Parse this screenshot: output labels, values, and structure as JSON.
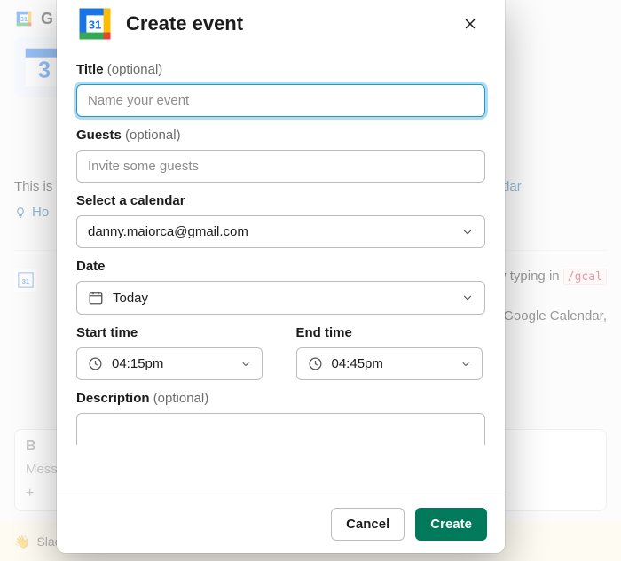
{
  "modal": {
    "title": "Create event",
    "fields": {
      "title": {
        "label": "Title",
        "optional": "(optional)",
        "placeholder": "Name your event"
      },
      "guests": {
        "label": "Guests",
        "optional": "(optional)",
        "placeholder": "Invite some guests"
      },
      "calendar": {
        "label": "Select a calendar",
        "value": "danny.maiorca@gmail.com"
      },
      "date": {
        "label": "Date",
        "value": "Today"
      },
      "start": {
        "label": "Start time",
        "value": "04:15pm"
      },
      "end": {
        "label": "End time",
        "value": "04:45pm"
      },
      "description": {
        "label": "Description",
        "optional": "(optional)"
      }
    },
    "buttons": {
      "cancel": "Cancel",
      "create": "Create"
    }
  },
  "background": {
    "header": "G",
    "intro_prefix": "This is",
    "link": "alendar",
    "hint": "Ho",
    "row1_right": "by typing in ",
    "row1_code": "/gcal",
    "row2_right": "g Google Calendar,",
    "composer_b": "B",
    "composer_msg": "Mess",
    "composer_plus": "+",
    "footer_text": "Slack needs your permission to enable notifications. Enable notifications"
  },
  "colors": {
    "primary_button": "#007a5a",
    "focus_ring": "#1d9bd1",
    "link": "#1264a3"
  }
}
